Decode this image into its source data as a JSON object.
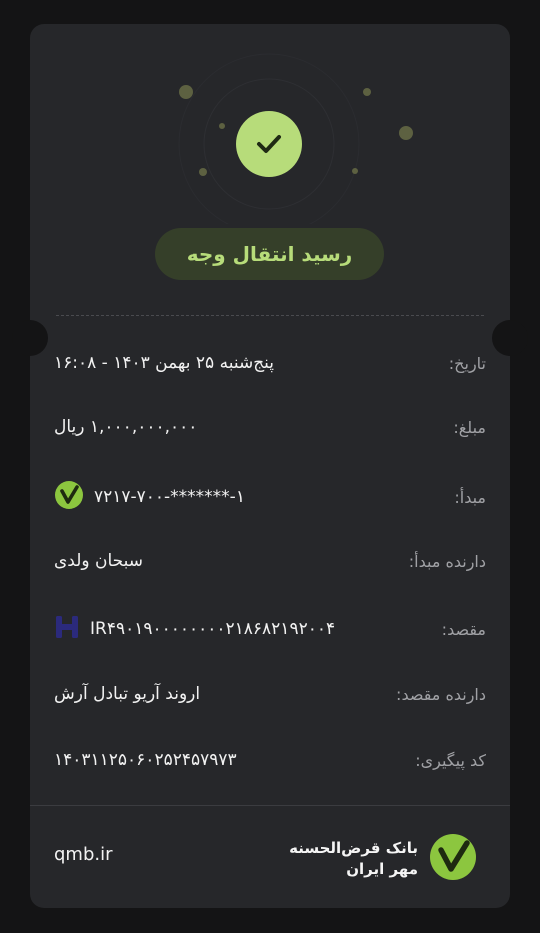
{
  "receipt": {
    "title": "رسید انتقال وجه",
    "rows": [
      {
        "label": "تاریخ:",
        "value": "پنج‌شنبه ۲۵ بهمن ۱۴۰۳ - ۱۶:۰۸"
      },
      {
        "label": "مبلغ:",
        "value": "۱,۰۰۰,۰۰۰,۰۰۰ ریال"
      },
      {
        "label": "مبدأ:",
        "value": "۷۲۱۷-۷۰۰-*******-۱",
        "icon": "mehr-iran-logo-icon"
      },
      {
        "label": "دارنده مبدأ:",
        "value": "سبحان ولدی"
      },
      {
        "label": "مقصد:",
        "value": "IR۴۹۰۱۹۰۰۰۰۰۰۰۰۲۱۸۶۸۲۱۹۲۰۰۴",
        "icon": "dest-bank-logo-icon"
      },
      {
        "label": "دارنده مقصد:",
        "value": "اروند آریو تبادل آرش"
      },
      {
        "label": "کد پیگیری:",
        "value": "۱۴۰۳۱۱۲۵۰۶۰۲۵۲۴۵۷۹۷۳"
      }
    ]
  },
  "footer": {
    "site": "qmb.ir",
    "bank_line1": "بانک قرض‌الحسنه",
    "bank_line2": "مهر ایران"
  },
  "colors": {
    "background": "#141415",
    "card": "#26272a",
    "accent": "#b7dc7a",
    "pill": "#353f29",
    "bank_green": "#8cc63f",
    "dest_bank_blue": "#2b2a7c"
  }
}
